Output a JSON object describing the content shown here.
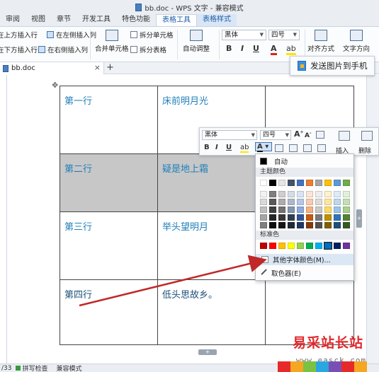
{
  "window": {
    "title": "bb.doc - WPS 文字 - 兼容模式"
  },
  "menu": {
    "tabs": [
      "审阅",
      "视图",
      "章节",
      "开发工具",
      "特色功能",
      "表格工具",
      "表格样式"
    ],
    "active": "表格工具"
  },
  "ribbon": {
    "insert_above": "在上方插入行",
    "insert_left": "在左侧插入列",
    "insert_below": "在下方插入行",
    "insert_right": "在右侧插入列",
    "merge": "合并单元格",
    "split_cells": "拆分单元格",
    "split_table": "拆分表格",
    "auto_fit": "自动调整",
    "font_name": "黑体",
    "font_size": "四号",
    "align": "对齐方式",
    "text_dir": "文字方向"
  },
  "doc_tab": {
    "name": "bb.doc",
    "close": "×",
    "new": "+"
  },
  "send_button": {
    "label": "发送图片到手机"
  },
  "table": {
    "rows": [
      [
        "第一行",
        "床前明月光",
        ""
      ],
      [
        "第二行",
        "疑是地上霜",
        ""
      ],
      [
        "第三行",
        "举头望明月",
        ""
      ],
      [
        "第四行",
        "低头思故乡。",
        ""
      ]
    ]
  },
  "mini_toolbar": {
    "font_name": "黑体",
    "font_size": "四号",
    "insert_label": "插入",
    "delete_label": "删除"
  },
  "color_menu": {
    "auto_label": "自动",
    "theme_label": "主题颜色",
    "standard_label": "标准色",
    "more_colors": "其他字体颜色(M)...",
    "picker": "取色器(E)",
    "theme_top": [
      "#ffffff",
      "#000000",
      "#e7e6e6",
      "#44546a",
      "#4472c4",
      "#ed7d31",
      "#a5a5a5",
      "#ffc000",
      "#5b9bd5",
      "#70ad47"
    ],
    "theme_shades": [
      [
        "#f2f2f2",
        "#7f7f7f",
        "#d0cece",
        "#d6dce4",
        "#dae3f3",
        "#fbe5d6",
        "#ededed",
        "#fff2cc",
        "#deebf7",
        "#e2f0d9"
      ],
      [
        "#d9d9d9",
        "#595959",
        "#aeabab",
        "#adb9ca",
        "#b4c7e7",
        "#f8cbad",
        "#dbdbdb",
        "#ffe699",
        "#bdd7ee",
        "#c5e0b4"
      ],
      [
        "#bfbfbf",
        "#404040",
        "#767171",
        "#8497b0",
        "#8faadc",
        "#f4b183",
        "#c9c9c9",
        "#ffd966",
        "#9dc3e6",
        "#a9d18e"
      ],
      [
        "#a6a6a6",
        "#262626",
        "#3b3838",
        "#333f50",
        "#2f5597",
        "#c55a11",
        "#7b7b7b",
        "#bf9000",
        "#2e75b6",
        "#548235"
      ],
      [
        "#7f7f7f",
        "#0d0d0d",
        "#171616",
        "#222a35",
        "#203864",
        "#843c0b",
        "#525252",
        "#7f6000",
        "#1f4e79",
        "#385723"
      ]
    ],
    "standard": [
      "#c00000",
      "#ff0000",
      "#ffc000",
      "#ffff00",
      "#92d050",
      "#00b050",
      "#00b0f0",
      "#0070c0",
      "#002060",
      "#7030a0"
    ]
  },
  "status": {
    "page": "/33",
    "spell": "拼写检查",
    "compat": "兼容模式"
  },
  "watermark": {
    "text": "易采站长站",
    "url": "www.easck.com"
  }
}
